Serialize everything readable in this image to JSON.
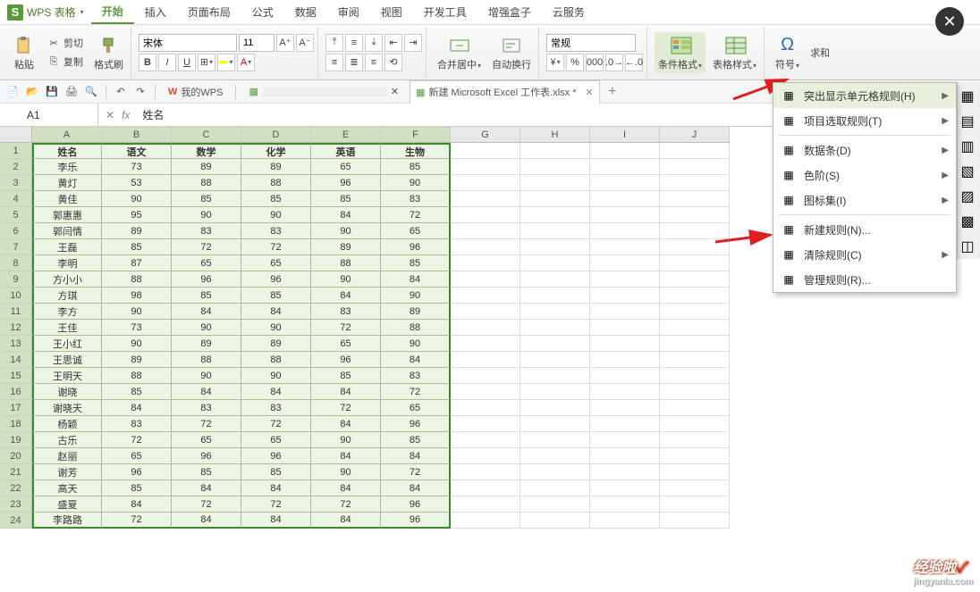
{
  "app": {
    "badge": "S",
    "name": "WPS 表格"
  },
  "menu": {
    "tabs": [
      "开始",
      "插入",
      "页面布局",
      "公式",
      "数据",
      "审阅",
      "视图",
      "开发工具",
      "增强盒子",
      "云服务"
    ],
    "active": 0
  },
  "ribbon": {
    "paste": "粘贴",
    "cut": "剪切",
    "copy": "复制",
    "fmtpainter": "格式刷",
    "font_name": "宋体",
    "font_size": "11",
    "bold": "B",
    "italic": "I",
    "underline": "U",
    "merge": "合并居中",
    "wrap": "自动换行",
    "numfmt": "常规",
    "condfmt": "条件格式",
    "tblstyle": "表格样式",
    "omega": "Ω",
    "symbol": "符号",
    "sum": "求和"
  },
  "qat": {
    "mywps": "我的WPS",
    "file2": "新建 Microsoft Excel 工作表.xlsx *"
  },
  "namebox": "A1",
  "formula": "姓名",
  "cols": {
    "letters": [
      "A",
      "B",
      "C",
      "D",
      "E",
      "F",
      "G",
      "H",
      "I",
      "J"
    ],
    "data_count": 6
  },
  "headers": [
    "姓名",
    "语文",
    "数学",
    "化学",
    "英语",
    "生物"
  ],
  "rows": [
    [
      "李乐",
      "73",
      "89",
      "89",
      "65",
      "85"
    ],
    [
      "黄灯",
      "53",
      "88",
      "88",
      "96",
      "90"
    ],
    [
      "黄佳",
      "90",
      "85",
      "85",
      "85",
      "83"
    ],
    [
      "郭惠惠",
      "95",
      "90",
      "90",
      "84",
      "72"
    ],
    [
      "郭闫情",
      "89",
      "83",
      "83",
      "90",
      "65"
    ],
    [
      "王磊",
      "85",
      "72",
      "72",
      "89",
      "96"
    ],
    [
      "李明",
      "87",
      "65",
      "65",
      "88",
      "85"
    ],
    [
      "方小小",
      "88",
      "96",
      "96",
      "90",
      "84"
    ],
    [
      "方琪",
      "98",
      "85",
      "85",
      "84",
      "90"
    ],
    [
      "李方",
      "90",
      "84",
      "84",
      "83",
      "89"
    ],
    [
      "王佳",
      "73",
      "90",
      "90",
      "72",
      "88"
    ],
    [
      "王小红",
      "90",
      "89",
      "89",
      "65",
      "90"
    ],
    [
      "王思诚",
      "89",
      "88",
      "88",
      "96",
      "84"
    ],
    [
      "王明天",
      "88",
      "90",
      "90",
      "85",
      "83"
    ],
    [
      "谢晓",
      "85",
      "84",
      "84",
      "84",
      "72"
    ],
    [
      "谢晓天",
      "84",
      "83",
      "83",
      "72",
      "65"
    ],
    [
      "杨颖",
      "83",
      "72",
      "72",
      "84",
      "96"
    ],
    [
      "古乐",
      "72",
      "65",
      "65",
      "90",
      "85"
    ],
    [
      "赵丽",
      "65",
      "96",
      "96",
      "84",
      "84"
    ],
    [
      "谢芳",
      "96",
      "85",
      "85",
      "90",
      "72"
    ],
    [
      "高天",
      "85",
      "84",
      "84",
      "84",
      "84"
    ],
    [
      "盛夏",
      "84",
      "72",
      "72",
      "72",
      "96"
    ],
    [
      "李路路",
      "72",
      "84",
      "84",
      "84",
      "96"
    ]
  ],
  "ctx": {
    "items": [
      {
        "label": "突出显示单元格规则(H)",
        "arrow": true,
        "icon": "highlight",
        "hover": true
      },
      {
        "label": "项目选取规则(T)",
        "arrow": true,
        "icon": "topbottom"
      },
      {
        "sep": true
      },
      {
        "label": "数据条(D)",
        "arrow": true,
        "icon": "databar"
      },
      {
        "label": "色阶(S)",
        "arrow": true,
        "icon": "colorscale"
      },
      {
        "label": "图标集(I)",
        "arrow": true,
        "icon": "iconset"
      },
      {
        "sep": true
      },
      {
        "label": "新建规则(N)...",
        "arrow": false,
        "icon": "newrule"
      },
      {
        "label": "清除规则(C)",
        "arrow": true,
        "icon": "clear"
      },
      {
        "label": "管理规则(R)...",
        "arrow": false,
        "icon": "manage"
      }
    ]
  },
  "watermark": {
    "text": "经验啦",
    "check": "✓",
    "url": "jingyanla.com"
  }
}
